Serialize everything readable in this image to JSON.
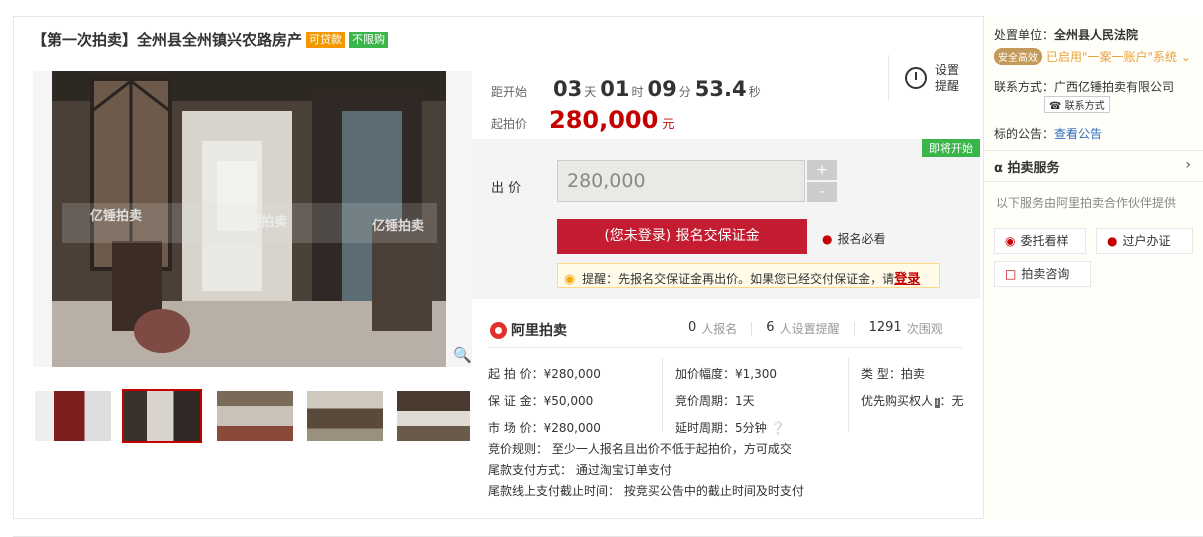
{
  "title": {
    "text": "【第一次拍卖】全州县全州镇兴农路房产",
    "tag_loan": "可贷款",
    "tag_norestrict": "不限购"
  },
  "countdown": {
    "label": "距开始",
    "days": "03",
    "days_unit": "天",
    "hours": "01",
    "hours_unit": "时",
    "minutes": "09",
    "minutes_unit": "分",
    "seconds": "53.4",
    "seconds_unit": "秒"
  },
  "start_price": {
    "label": "起拍价",
    "value": "280,000",
    "unit": "元"
  },
  "remind": {
    "label": "设置提醒"
  },
  "bid": {
    "status_badge": "即将开始",
    "label": "出  价",
    "input_value": "280,000",
    "plus": "+",
    "minus": "-",
    "signup_button": "(您未登录) 报名交保证金",
    "must_read": "报名必看",
    "tip_text": "提醒：先报名交保证金再出价。如果您已经交付保证金，请",
    "tip_login": "登录"
  },
  "platform": {
    "name": "阿里拍卖",
    "signups": "0",
    "signups_unit": "人报名",
    "reminders": "6",
    "reminders_unit": "人设置提醒",
    "views": "1291",
    "views_unit": "次围观"
  },
  "info": {
    "col1": [
      "起 拍 价：¥280,000",
      "保 证 金：¥50,000",
      "市 场 价：¥280,000"
    ],
    "col2": [
      "加价幅度：¥1,300",
      "竞价周期：1天",
      "延时周期：5分钟"
    ],
    "col3_type": "类    型：",
    "col3_type_val": "拍卖",
    "col3_priority": "优先购买权人",
    "col3_priority_val": "：无",
    "rules": [
      "竞价规则：  至少一人报名且出价不低于起拍价，方可成交",
      "尾款支付方式：  通过淘宝订单支付",
      "尾款线上支付截止时间：  按竞买公告中的截止时间及时支付"
    ]
  },
  "right": {
    "org_label": "处置单位：",
    "org_value": "全州县人民法院",
    "safe_badge": "安全高效",
    "safe_link": "已启用\"一案一账户\"系统 ⌄",
    "contact_label": "联系方式：",
    "contact_value": "广西亿锤拍卖有限公司",
    "phone_btn": "联系方式",
    "notice_label": "标的公告：",
    "notice_link": "查看公告",
    "service_title": "拍卖服务",
    "service_sub": "以下服务由阿里拍卖合作伙伴提供",
    "btn_view": "委托看样",
    "btn_transfer": "过户办证",
    "btn_consult": "拍卖咨询"
  },
  "watermark": "亿锤拍卖",
  "colors": {
    "accent_red": "#c40000",
    "signup_red": "#c41c30",
    "tag_orange": "#f39800",
    "tag_green": "#3bb54a"
  }
}
